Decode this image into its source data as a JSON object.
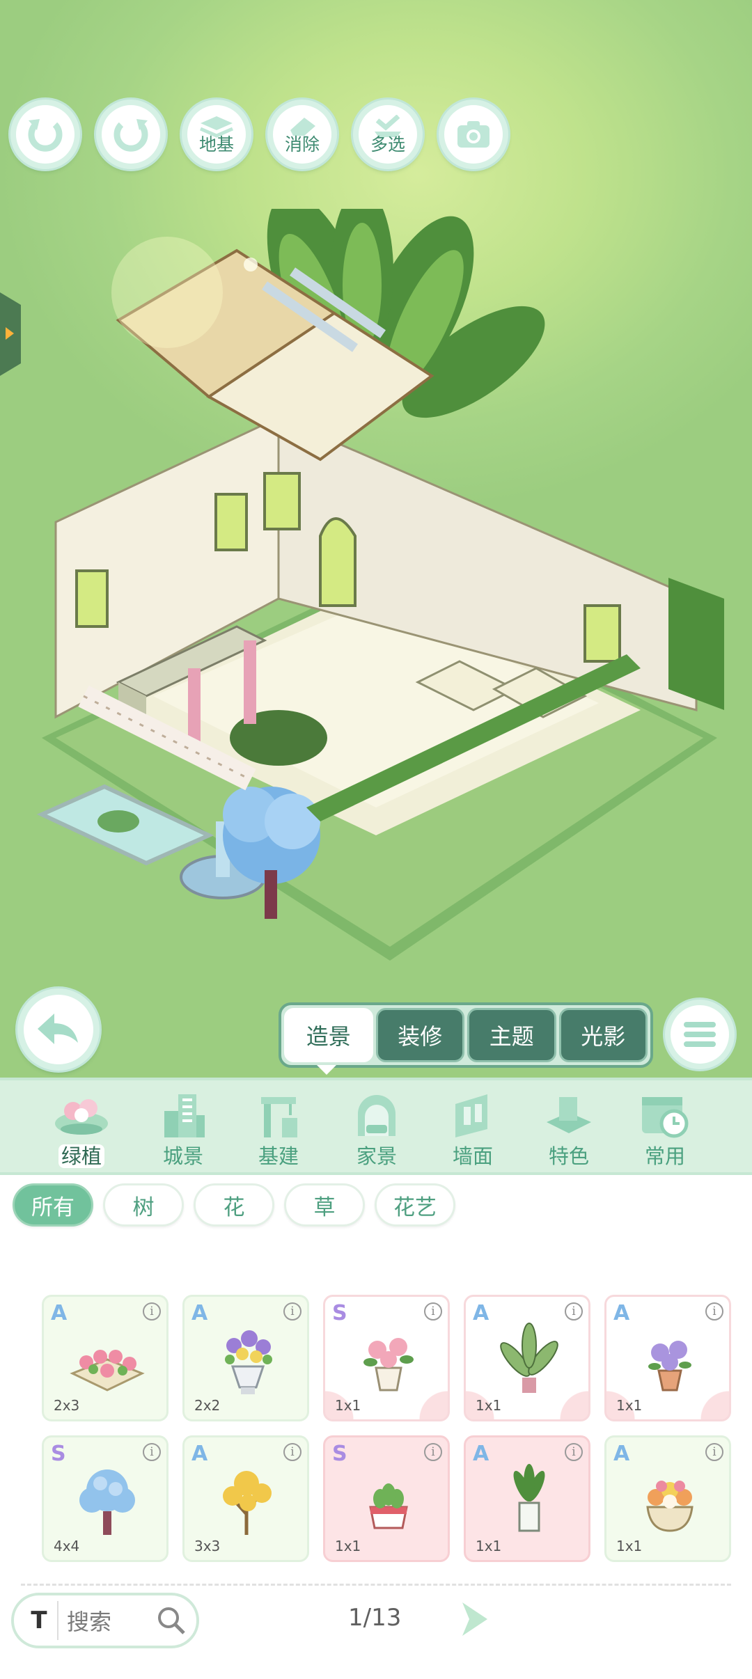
{
  "toolbar": {
    "undo_label": "",
    "redo_label": "",
    "foundation_label": "地基",
    "erase_label": "消除",
    "multiselect_label": "多选",
    "camera_label": ""
  },
  "mode_tabs": [
    {
      "label": "造景",
      "active": true
    },
    {
      "label": "装修",
      "active": false
    },
    {
      "label": "主题",
      "active": false
    },
    {
      "label": "光影",
      "active": false
    }
  ],
  "categories": [
    {
      "label": "绿植",
      "icon": "flower-pot-icon",
      "active": true
    },
    {
      "label": "城景",
      "icon": "city-building-icon",
      "active": false
    },
    {
      "label": "基建",
      "icon": "crane-icon",
      "active": false
    },
    {
      "label": "家景",
      "icon": "home-arch-icon",
      "active": false
    },
    {
      "label": "墙面",
      "icon": "wall-panel-icon",
      "active": false
    },
    {
      "label": "特色",
      "icon": "special-box-icon",
      "active": false
    },
    {
      "label": "常用",
      "icon": "calendar-clock-icon",
      "active": false
    }
  ],
  "filters": [
    {
      "label": "所有",
      "active": true
    },
    {
      "label": "树",
      "active": false
    },
    {
      "label": "花",
      "active": false
    },
    {
      "label": "草",
      "active": false
    },
    {
      "label": "花艺",
      "active": false
    }
  ],
  "items": [
    {
      "grade": "A",
      "size": "2x3",
      "style": "green",
      "icon": "flower-planter-icon"
    },
    {
      "grade": "A",
      "size": "2x2",
      "style": "green",
      "icon": "flower-vase-icon"
    },
    {
      "grade": "S",
      "size": "1x1",
      "style": "pink",
      "icon": "pink-flower-pot-icon"
    },
    {
      "grade": "A",
      "size": "1x1",
      "style": "pink",
      "icon": "leafy-plant-icon"
    },
    {
      "grade": "A",
      "size": "1x1",
      "style": "pink",
      "icon": "purple-flower-pot-icon"
    },
    {
      "grade": "S",
      "size": "4x4",
      "style": "green",
      "icon": "blue-tree-icon"
    },
    {
      "grade": "A",
      "size": "3x3",
      "style": "green",
      "icon": "yellow-tree-icon"
    },
    {
      "grade": "S",
      "size": "1x1",
      "style": "pink2",
      "icon": "succulent-pot-icon"
    },
    {
      "grade": "A",
      "size": "1x1",
      "style": "pink2",
      "icon": "glass-plant-icon"
    },
    {
      "grade": "A",
      "size": "1x1",
      "style": "green",
      "icon": "flower-bowl-icon"
    }
  ],
  "search": {
    "placeholder": "搜索",
    "prefix": "T"
  },
  "pagination": {
    "text": "1/13",
    "current": 1,
    "total": 13
  },
  "colors": {
    "accent": "#71c29c",
    "scene_bg": "#a9d58a",
    "tab_dark": "#477c6a"
  }
}
